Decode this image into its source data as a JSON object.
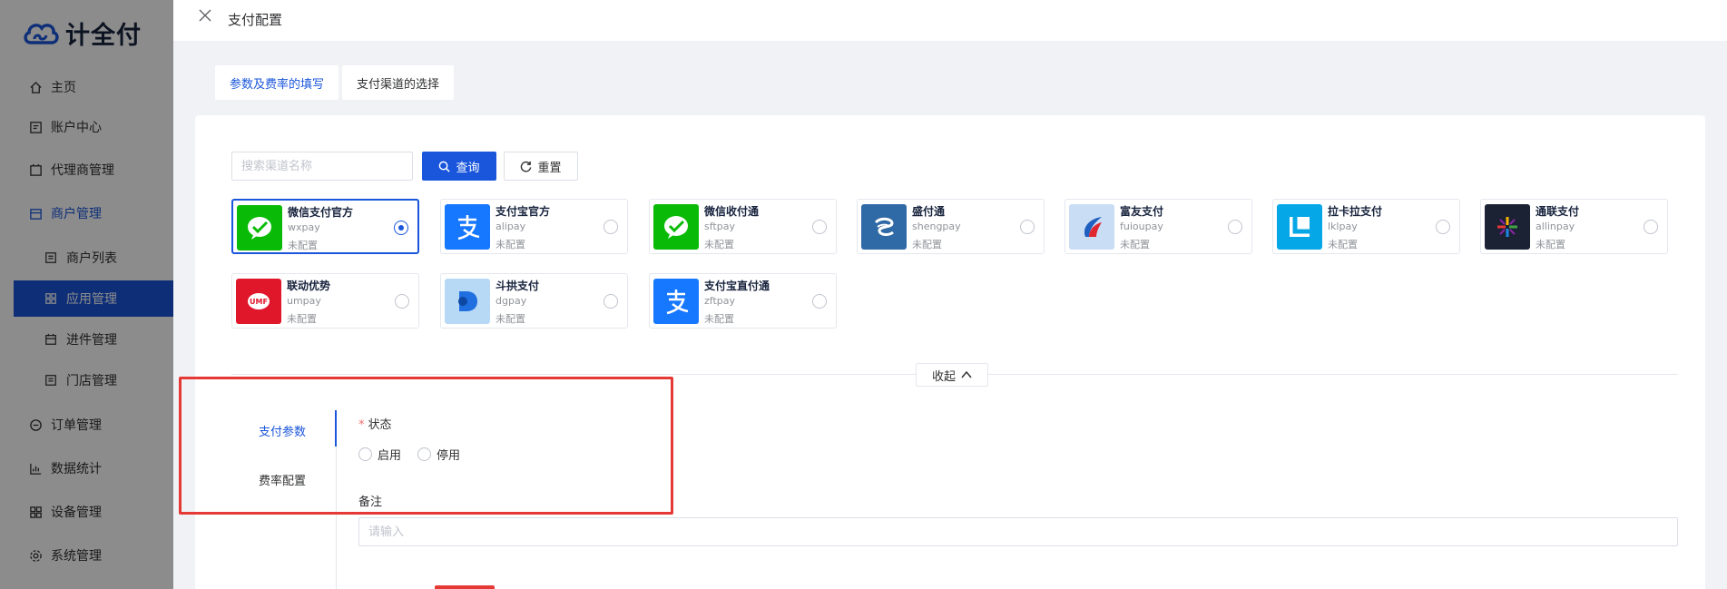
{
  "sidebar": {
    "logo_text": "计全付",
    "items": [
      {
        "label": "主页",
        "icon": "home-icon"
      },
      {
        "label": "账户中心",
        "icon": "account-icon"
      },
      {
        "label": "代理商管理",
        "icon": "agent-icon"
      },
      {
        "label": "商户管理",
        "icon": "merchant-icon"
      },
      {
        "label": "商户列表",
        "icon": "list-icon"
      },
      {
        "label": "应用管理",
        "icon": "grid-icon"
      },
      {
        "label": "进件管理",
        "icon": "calendar-icon"
      },
      {
        "label": "门店管理",
        "icon": "store-icon"
      },
      {
        "label": "订单管理",
        "icon": "order-icon"
      },
      {
        "label": "数据统计",
        "icon": "chart-icon"
      },
      {
        "label": "设备管理",
        "icon": "device-icon"
      },
      {
        "label": "系统管理",
        "icon": "gear-icon"
      }
    ]
  },
  "drawer": {
    "title": "支付配置",
    "tabs": [
      {
        "label": "参数及费率的填写"
      },
      {
        "label": "支付渠道的选择"
      }
    ]
  },
  "search": {
    "placeholder": "搜索渠道名称",
    "query_label": "查询",
    "reset_label": "重置"
  },
  "channels": [
    {
      "name": "微信支付官方",
      "code": "wxpay",
      "status": "未配置",
      "selected": true,
      "logo_color": "#09bb07"
    },
    {
      "name": "支付宝官方",
      "code": "alipay",
      "status": "未配置",
      "selected": false,
      "logo_color": "#1677ff"
    },
    {
      "name": "微信收付通",
      "code": "sftpay",
      "status": "未配置",
      "selected": false,
      "logo_color": "#09bb07"
    },
    {
      "name": "盛付通",
      "code": "shengpay",
      "status": "未配置",
      "selected": false,
      "logo_color": "#2f6aa6"
    },
    {
      "name": "富友支付",
      "code": "fuioupay",
      "status": "未配置",
      "selected": false,
      "logo_color": "#c9ddf5"
    },
    {
      "name": "拉卡拉支付",
      "code": "lklpay",
      "status": "未配置",
      "selected": false,
      "logo_color": "#05a7e6"
    },
    {
      "name": "通联支付",
      "code": "allinpay",
      "status": "未配置",
      "selected": false,
      "logo_color": "#1b2233"
    },
    {
      "name": "联动优势",
      "code": "umpay",
      "status": "未配置",
      "selected": false,
      "logo_color": "#e0162b"
    },
    {
      "name": "斗拱支付",
      "code": "dgpay",
      "status": "未配置",
      "selected": false,
      "logo_color": "#b8d9f6"
    },
    {
      "name": "支付宝直付通",
      "code": "zftpay",
      "status": "未配置",
      "selected": false,
      "logo_color": "#1677ff"
    }
  ],
  "collapse_label": "收起",
  "config": {
    "side_tabs": [
      {
        "label": "支付参数"
      },
      {
        "label": "费率配置"
      }
    ],
    "status_label": "状态",
    "status_options": [
      "启用",
      "停用"
    ],
    "remark_label": "备注",
    "remark_placeholder": "请输入"
  },
  "colors": {
    "primary": "#1a56db",
    "highlight": "#e53935"
  }
}
